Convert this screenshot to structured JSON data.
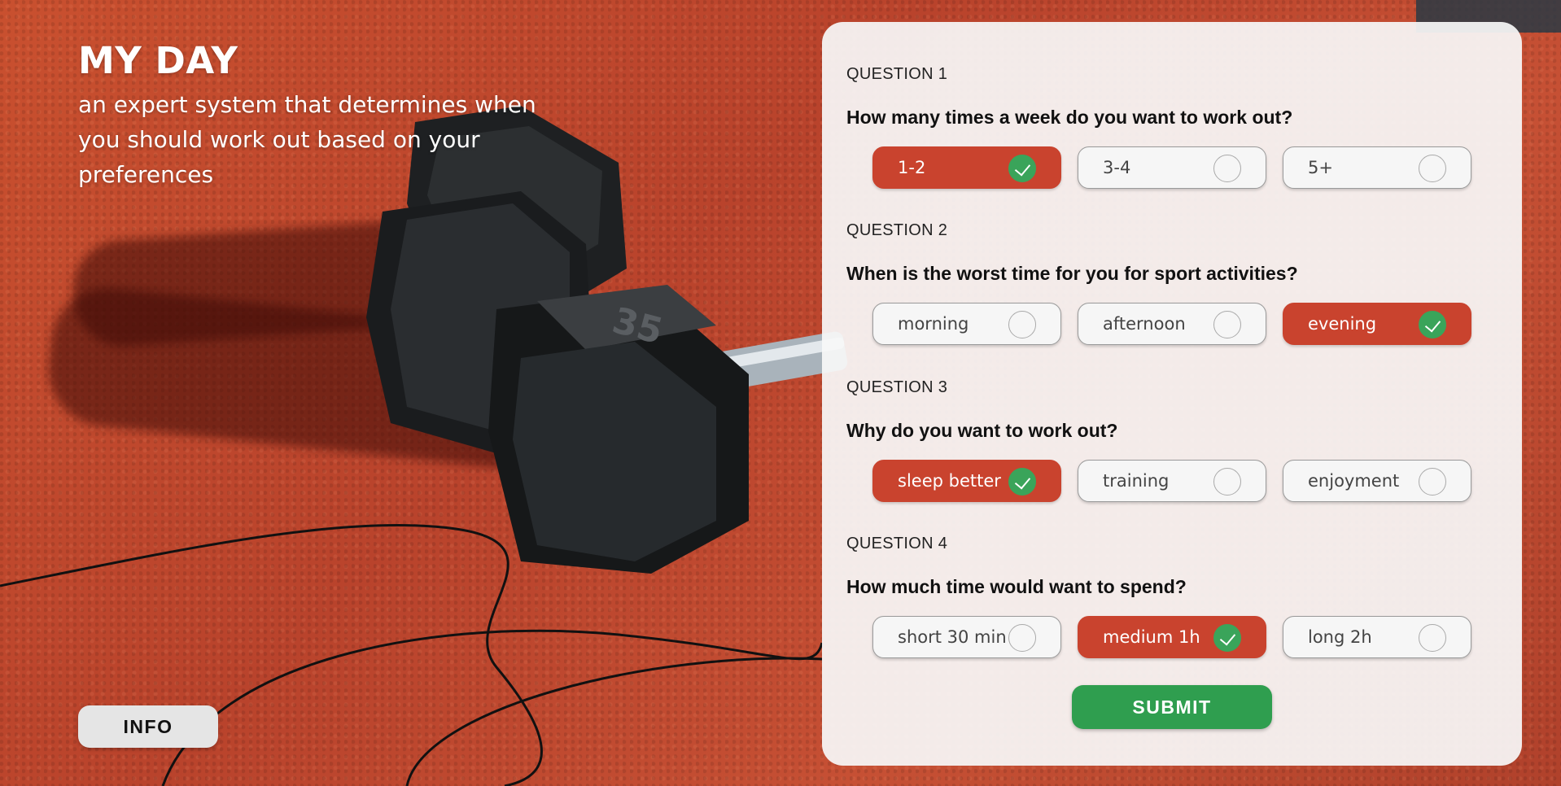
{
  "hero": {
    "title": "MY DAY",
    "subtitle": "an expert system that determines when you should work out based on your preferences"
  },
  "info_button": {
    "label": "INFO"
  },
  "colors": {
    "selected_option": "#c9432e",
    "check_badge": "#3aa45a",
    "submit": "#2f9e4f",
    "panel": "#f8f8f8"
  },
  "questions": [
    {
      "number": "QUESTION 1",
      "text": "How many times a week do you want to work out?",
      "options": [
        {
          "label": "1-2",
          "selected": true
        },
        {
          "label": "3-4",
          "selected": false
        },
        {
          "label": "5+",
          "selected": false
        }
      ]
    },
    {
      "number": "QUESTION 2",
      "text": "When is the worst time for you for sport activities?",
      "options": [
        {
          "label": "morning",
          "selected": false
        },
        {
          "label": "afternoon",
          "selected": false
        },
        {
          "label": "evening",
          "selected": true
        }
      ]
    },
    {
      "number": "QUESTION 3",
      "text": "Why do you want to work out?",
      "options": [
        {
          "label": "sleep better",
          "selected": true
        },
        {
          "label": "training",
          "selected": false
        },
        {
          "label": "enjoyment",
          "selected": false
        }
      ]
    },
    {
      "number": "QUESTION 4",
      "text": "How much time would want to spend?",
      "options": [
        {
          "label": "short 30 min",
          "selected": false
        },
        {
          "label": "medium 1h",
          "selected": true
        },
        {
          "label": "long 2h",
          "selected": false
        }
      ]
    }
  ],
  "submit_button": {
    "label": "SUBMIT"
  },
  "background": {
    "icons": [
      "dumbbell-photo"
    ],
    "weight_marking": "35"
  }
}
